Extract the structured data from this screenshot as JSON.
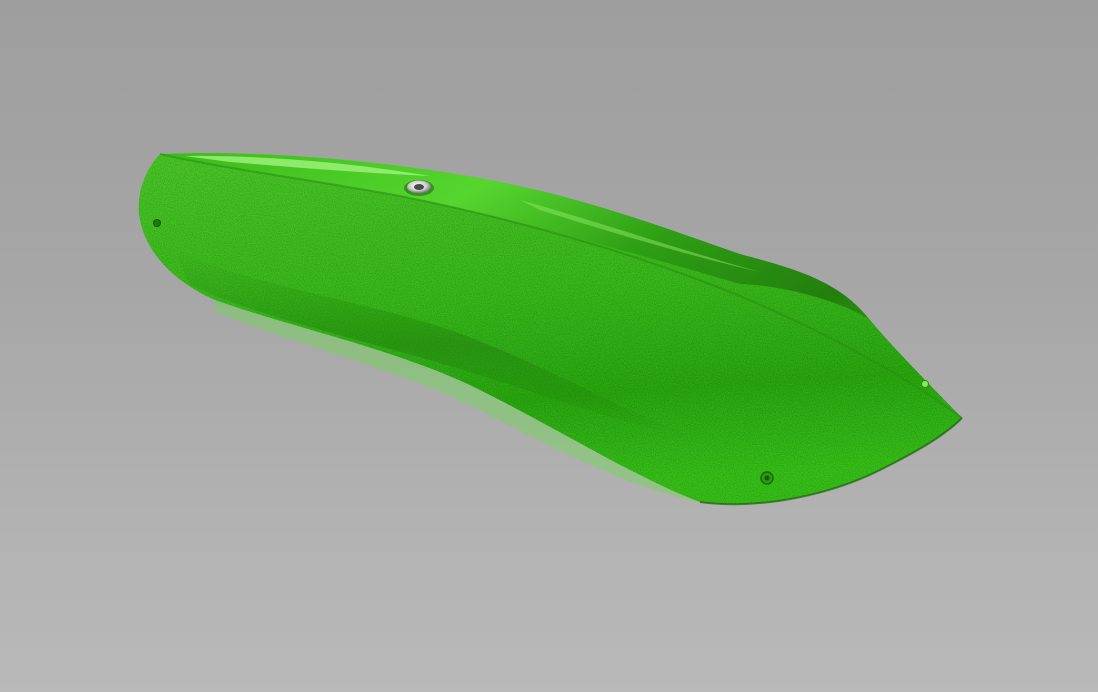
{
  "scene": {
    "subject": "climbing-hold-render",
    "colors": {
      "background_top": "#9e9e9e",
      "background_bottom": "#b9b9b9",
      "hold_bright": "#5fe03a",
      "hold_mid": "#3dc71e",
      "hold_dark": "#1f8a0c",
      "hold_glossy_highlight": "#9cf07a",
      "bolt_metal": "#d8d8d8"
    },
    "features": [
      "textured-front-face",
      "glossy-top-surface",
      "center-bolt",
      "screw-hole-left",
      "screw-hole-right-top",
      "screw-hole-bottom-right"
    ]
  }
}
